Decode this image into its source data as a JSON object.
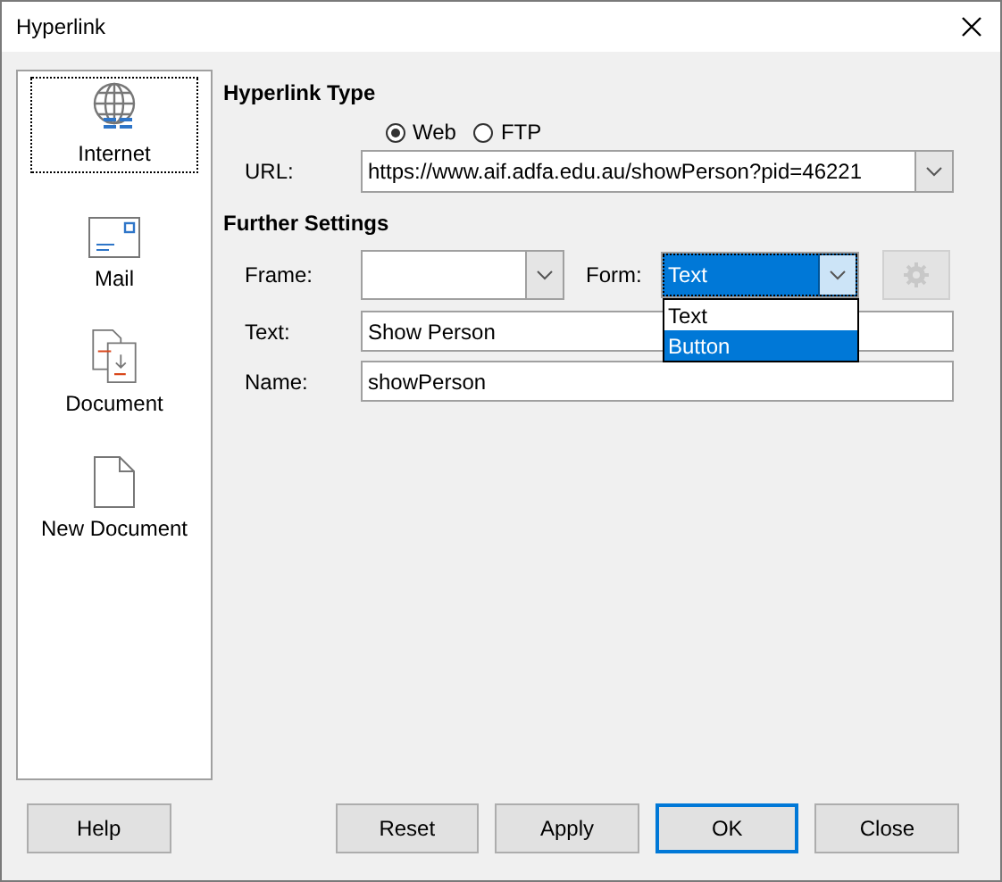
{
  "window": {
    "title": "Hyperlink"
  },
  "categories": [
    {
      "label": "Internet",
      "kind": "globe",
      "selected": true
    },
    {
      "label": "Mail",
      "kind": "mail",
      "selected": false
    },
    {
      "label": "Document",
      "kind": "document",
      "selected": false
    },
    {
      "label": "New Document",
      "kind": "new",
      "selected": false
    }
  ],
  "hyperlink_type": {
    "heading": "Hyperlink Type",
    "protocols": [
      {
        "label": "Web",
        "selected": true
      },
      {
        "label": "FTP",
        "selected": false
      }
    ],
    "url_label": "URL:",
    "url": "https://www.aif.adfa.edu.au/showPerson?pid=46221"
  },
  "further_settings": {
    "heading": "Further Settings",
    "frame_label": "Frame:",
    "form_label": "Form:",
    "form_value": "Text",
    "form_options": [
      {
        "label": "Text",
        "selected": false
      },
      {
        "label": "Button",
        "selected": true
      }
    ],
    "events_button": {
      "disabled": true
    },
    "text_label": "Text:",
    "text_value": "Show Person",
    "name_label": "Name:",
    "name_value": "showPerson"
  },
  "buttons": [
    {
      "label": "Help",
      "default": false
    },
    {
      "label": "Reset",
      "default": false
    },
    {
      "label": "Apply",
      "default": false
    },
    {
      "label": "OK",
      "default": true
    },
    {
      "label": "Close",
      "default": false
    }
  ]
}
